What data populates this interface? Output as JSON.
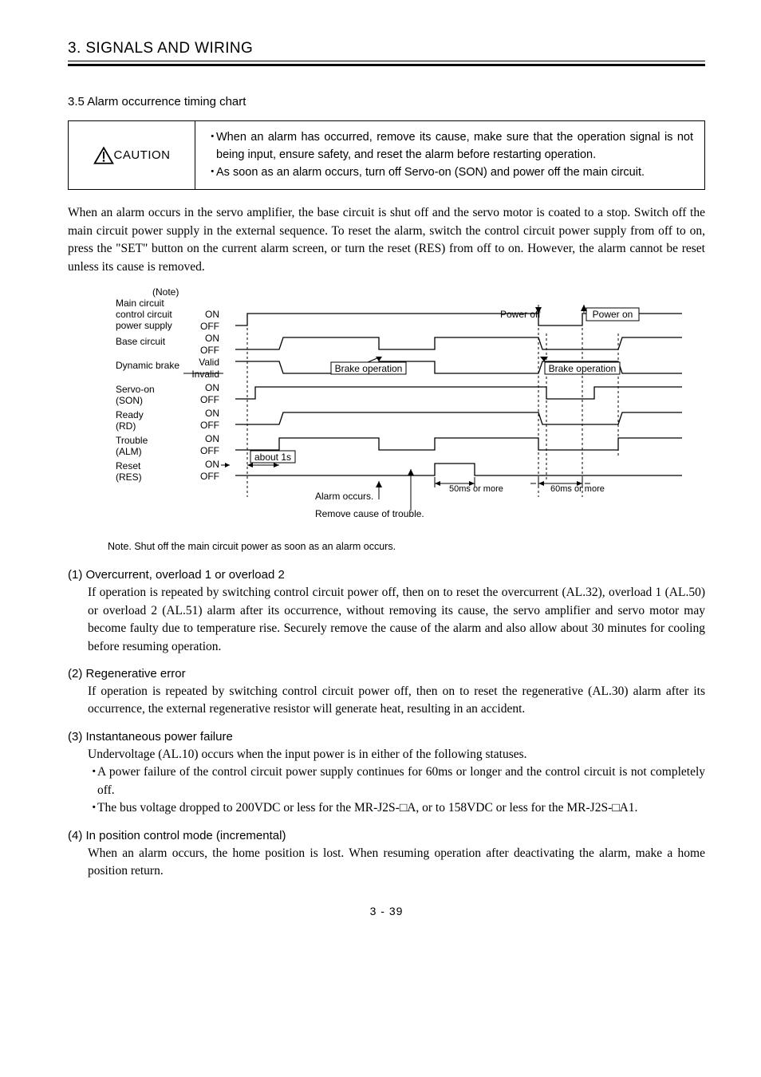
{
  "chapter_title": "3. SIGNALS AND WIRING",
  "subsection": "3.5 Alarm occurrence timing chart",
  "caution": {
    "label": "CAUTION",
    "bullet_mark": "・",
    "items": [
      "When an alarm has occurred, remove its cause, make sure that the operation signal is not being input, ensure safety, and reset the alarm before restarting operation.",
      "As soon as an alarm occurs, turn off Servo-on (SON) and power off the main circuit."
    ]
  },
  "intro_para": "When an alarm occurs in the servo amplifier, the base circuit is shut off and the servo motor is coated to a stop. Switch off the main circuit power supply in the external sequence. To reset the alarm, switch the control circuit power supply from off to on, press the \"SET\" button on the current alarm screen, or turn the reset (RES) from off to on. However, the alarm cannot be reset unless its cause is removed.",
  "chart_labels": {
    "note_head": "(Note)",
    "row_main": "Main circuit\ncontrol circuit\npower supply",
    "row_base": "Base circuit",
    "row_brake": "Dynamic brake",
    "row_son": "Servo-on\n(SON)",
    "row_rd": "Ready\n(RD)",
    "row_alm": "Trouble\n(ALM)",
    "row_res": "Reset\n(RES)",
    "on": "ON",
    "off": "OFF",
    "valid": "Valid",
    "invalid": "Invalid",
    "brake_op": "Brake operation",
    "about1s": "about 1s",
    "alarm_occurs": "Alarm occurs.",
    "remove_cause": "Remove cause of trouble.",
    "t50": "50ms or more",
    "t60": "60ms or more",
    "power_off": "Power off",
    "power_on": "Power on"
  },
  "chart_note": "Note. Shut off the main circuit power as soon as an alarm occurs.",
  "items": [
    {
      "head": "(1) Overcurrent, overload 1 or overload 2",
      "body": "If operation is repeated by switching control circuit power off, then on to reset the overcurrent (AL.32), overload 1 (AL.50) or overload 2 (AL.51) alarm after its occurrence, without removing its cause, the servo amplifier and servo motor may become faulty due to temperature rise. Securely remove the cause of the alarm and also allow about 30 minutes for cooling before resuming operation."
    },
    {
      "head": "(2) Regenerative error",
      "body": "If operation is repeated by switching control circuit power off, then on to reset the regenerative (AL.30) alarm after its occurrence, the external regenerative resistor will generate heat, resulting in an accident."
    },
    {
      "head": "(3) Instantaneous power failure",
      "body_intro": "Undervoltage (AL.10) occurs when the input power is in either of the following statuses.",
      "bullets": [
        "A power failure of the control circuit power supply continues for 60ms or longer and the control circuit is not completely off.",
        "The bus voltage dropped to 200VDC or less for the MR-J2S-□A, or to 158VDC or less for the MR-J2S-□A1."
      ]
    },
    {
      "head": "(4) In position control mode (incremental)",
      "body": "When an alarm occurs, the home position is lost. When resuming operation after deactivating the alarm, make a home position return."
    }
  ],
  "page_number": "3 -  39"
}
